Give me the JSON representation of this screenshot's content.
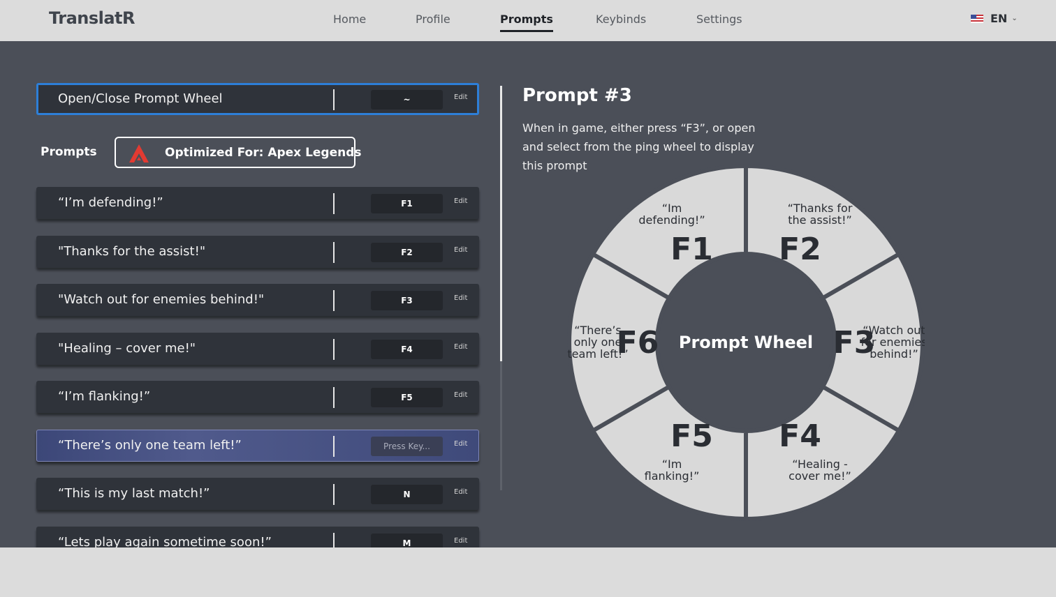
{
  "app": {
    "name": "TranslatR"
  },
  "nav": {
    "items": [
      {
        "label": "Home",
        "active": false
      },
      {
        "label": "Profile",
        "active": false
      },
      {
        "label": "Prompts",
        "active": true
      },
      {
        "label": "Keybinds",
        "active": false
      },
      {
        "label": "Settings",
        "active": false
      }
    ],
    "language": {
      "code": "EN",
      "flag_icon": "us-flag-icon"
    }
  },
  "wheel_toggle": {
    "label": "Open/Close Prompt Wheel",
    "key": "~",
    "edit_label": "Edit"
  },
  "prompts_section": {
    "heading": "Prompts",
    "game_badge": {
      "label": "Optimized For: Apex Legends",
      "icon": "apex-legends-logo-icon"
    }
  },
  "prompts": [
    {
      "label": "“I’m defending!”",
      "key": "F1",
      "edit_label": "Edit"
    },
    {
      "label": "\"Thanks for the assist!\"",
      "key": "F2",
      "edit_label": "Edit"
    },
    {
      "label": "\"Watch out for enemies behind!\"",
      "key": "F3",
      "edit_label": "Edit"
    },
    {
      "label": "\"Healing – cover me!\"",
      "key": "F4",
      "edit_label": "Edit"
    },
    {
      "label": "“I’m flanking!”",
      "key": "F5",
      "edit_label": "Edit"
    },
    {
      "label": "“There’s only one team left!”",
      "key": "Press Key...",
      "edit_label": "Edit",
      "state": "listening"
    },
    {
      "label": "“This is my last match!”",
      "key": "N",
      "edit_label": "Edit"
    },
    {
      "label": "“Lets play again sometime soon!”",
      "key": "M",
      "edit_label": "Edit"
    }
  ],
  "detail": {
    "title": "Prompt #3",
    "description": "When in game, either press “F3”, or open and select from the ping wheel to display this prompt"
  },
  "wheel": {
    "center_label": "Prompt Wheel",
    "segments": [
      {
        "key": "F1",
        "text_lines": [
          "“Im",
          "defending!”"
        ]
      },
      {
        "key": "F2",
        "text_lines": [
          "“Thanks for",
          "the assist!”"
        ]
      },
      {
        "key": "F3",
        "text_lines": [
          "“Watch out",
          "for enemies",
          "behind!”"
        ]
      },
      {
        "key": "F4",
        "text_lines": [
          "“Healing -",
          "cover me!”"
        ]
      },
      {
        "key": "F5",
        "text_lines": [
          "“Im",
          "flanking!”"
        ]
      },
      {
        "key": "F6",
        "text_lines": [
          "“There’s",
          "only one",
          "team left!”"
        ]
      }
    ],
    "colors": {
      "segment": "#d9d9d9",
      "gap": "#4b4f58",
      "center": "#4b4f58",
      "text": "#2a2d33",
      "center_text": "#ffffff"
    }
  },
  "colors": {
    "accent": "#2d7fd8",
    "listening": "#4a5488",
    "panel": "#4b4f58",
    "row": "#2f333a"
  }
}
